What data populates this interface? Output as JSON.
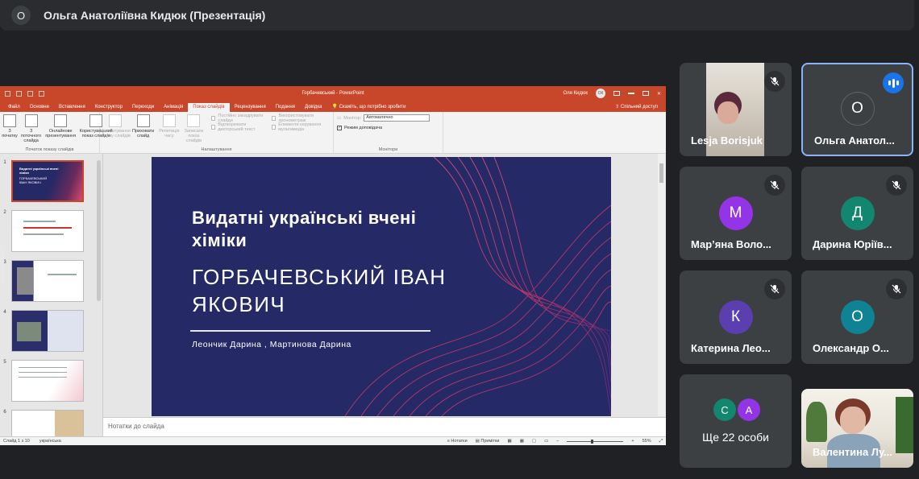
{
  "presenter": {
    "avatar": "О",
    "title": "Ольга Анатоліївна Кидюк (Презентація)"
  },
  "ppt": {
    "doc_title": "Горбачевський  -  PowerPoint",
    "user": "Оля Кидюк",
    "user_initials": "ОК",
    "tabs": [
      "Файл",
      "Основне",
      "Вставлення",
      "Конструктор",
      "Переходи",
      "Анімація",
      "Показ слайдів",
      "Рецензування",
      "Подання",
      "Довідка",
      "Скажіть, що потрібно зробити"
    ],
    "active_tab": "Показ слайдів",
    "share": "Спільний доступ",
    "ribbon": {
      "b1": "З початку",
      "b2": "З поточного слайда",
      "b3": "Онлайнове презентування",
      "b4": "Користувацький показ слайдів",
      "g1": "Початок показу слайдів",
      "b5": "Налаштування показу слайдів",
      "b6": "Приховати слайд",
      "b7": "Репетиція часу",
      "b8": "Записати показ слайдів",
      "c1": "Постійно закадрувати слайди",
      "c2": "Відтворювати дикторський текст",
      "c3": "Використовувати хронометраж",
      "c4": "Елементи керування мультимедіа",
      "g2": "Налаштування",
      "monitor_label": "Монітор:",
      "monitor_value": "Автоматично",
      "presenter_view": "Режим доповідача",
      "g3": "Монітори"
    },
    "thumbs": [
      {
        "n": "1",
        "t": "Видатні українські вчені хіміки",
        "s": "ГОРБАЧЕВСЬКИЙ ІВАН ЯКОВИЧ"
      },
      {
        "n": "2"
      },
      {
        "n": "3"
      },
      {
        "n": "4"
      },
      {
        "n": "5"
      },
      {
        "n": "6"
      }
    ],
    "slide": {
      "title": "Видатні  українські вчені хіміки",
      "name": "ГОРБАЧЕВСЬКИЙ ІВАН ЯКОВИЧ",
      "authors": "Леончик Дарина , Мартинова Дарина"
    },
    "notes_placeholder": "Нотатки до слайда",
    "status": {
      "slide": "Слайд 1 з 10",
      "lang": "українська",
      "notes": "Нотатки",
      "comments": "Примітки",
      "zoom": "55%"
    }
  },
  "participants": [
    {
      "name": "Lesja Borisjuk",
      "type": "photo",
      "muted": true
    },
    {
      "name": "Ольга Анатол...",
      "avatar": "О",
      "color": "#3c4043",
      "speaking": true
    },
    {
      "name": "Мар’яна Воло...",
      "avatar": "М",
      "color": "#9334e6",
      "muted": true
    },
    {
      "name": "Дарина Юріїв...",
      "avatar": "Д",
      "color": "#12866f",
      "muted": true
    },
    {
      "name": "Катерина Лео...",
      "avatar": "К",
      "color": "#5b3fb0",
      "muted": true
    },
    {
      "name": "Олександр О...",
      "avatar": "О",
      "color": "#0f8294",
      "muted": true
    },
    {
      "more": "Ще 22 особи",
      "avs": [
        {
          "l": "С",
          "c": "#12866f"
        },
        {
          "l": "А",
          "c": "#9334e6"
        }
      ]
    },
    {
      "name": "Валентина Лу...",
      "type": "photo"
    }
  ]
}
